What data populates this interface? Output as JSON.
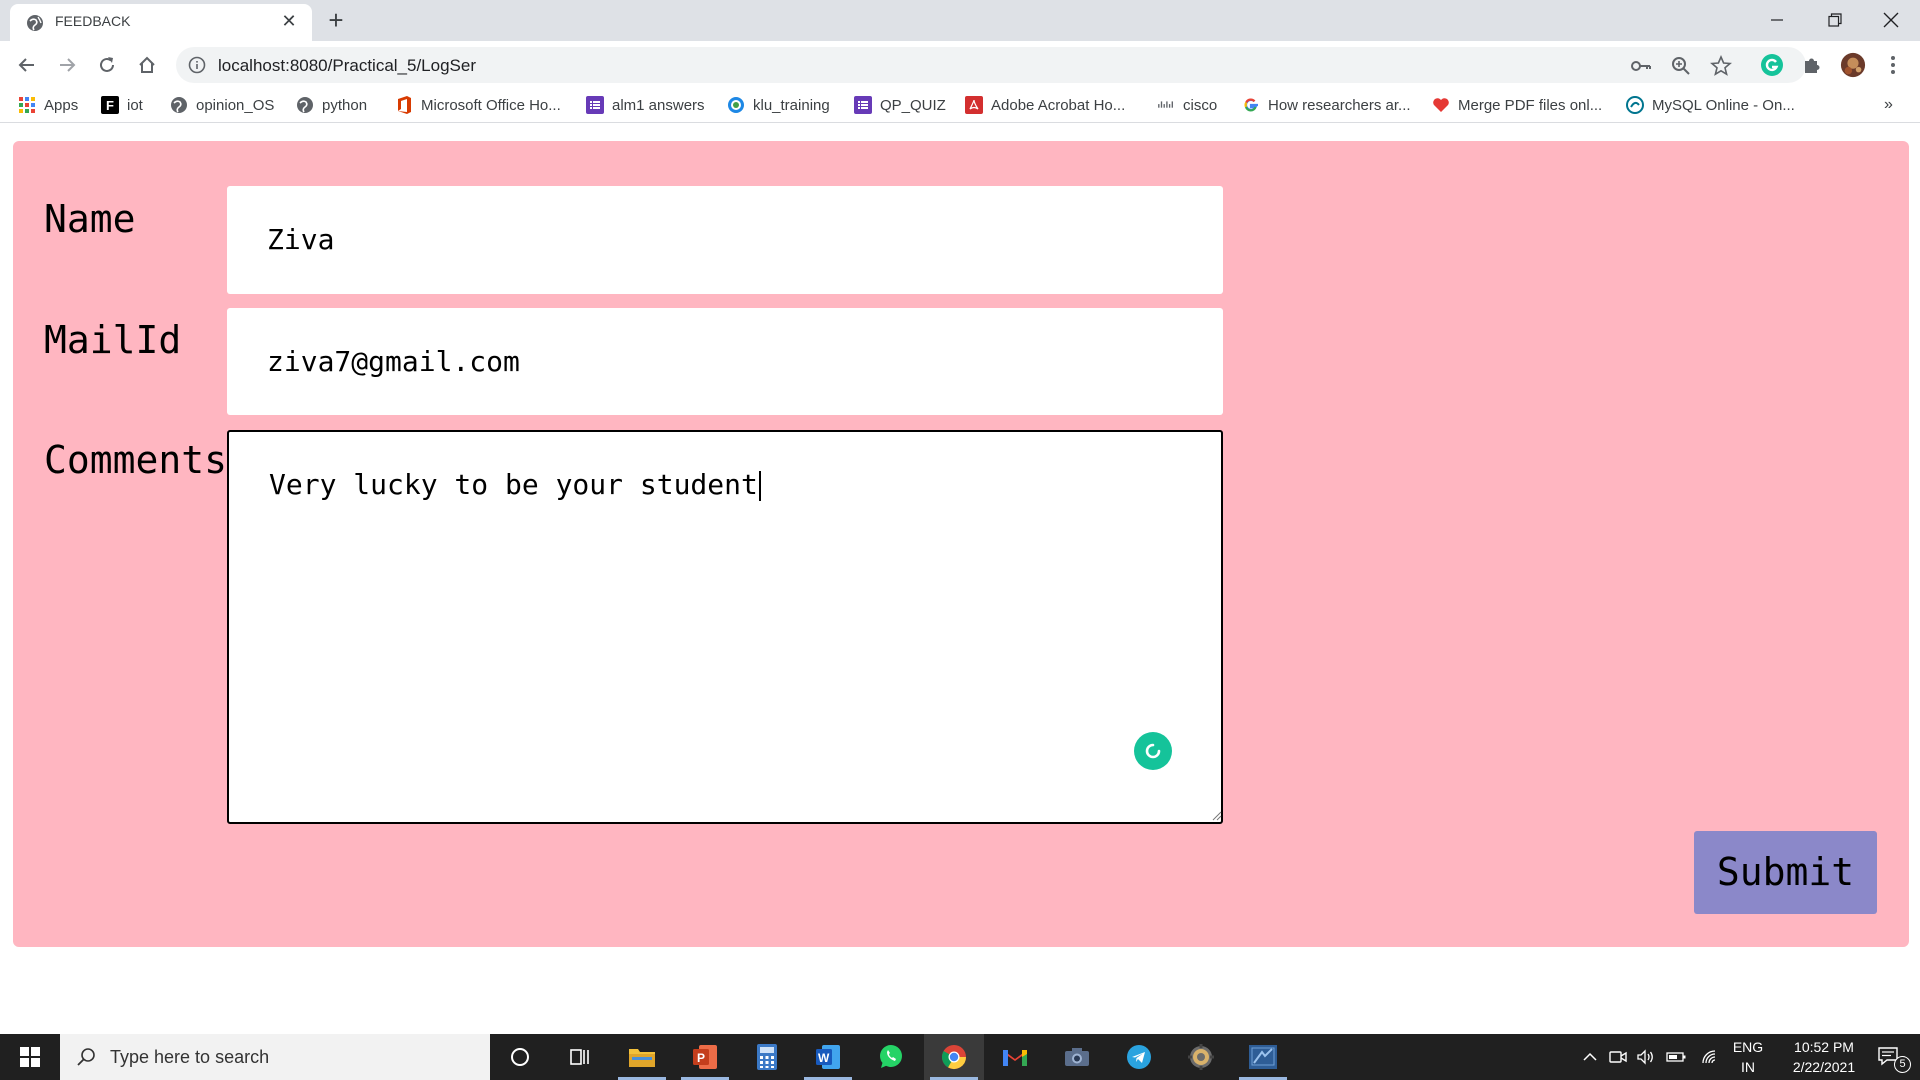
{
  "browser": {
    "tab_title": "FEEDBACK",
    "url": "localhost:8080/Practical_5/LogSer",
    "bookmarks": [
      {
        "label": "Apps",
        "icon": "apps-grid-icon",
        "color": "#4285f4"
      },
      {
        "label": "iot",
        "icon": "f-logo-icon",
        "color": "#000000"
      },
      {
        "label": "opinion_OS",
        "icon": "globe-icon",
        "color": "#5f6368"
      },
      {
        "label": "python",
        "icon": "globe-icon",
        "color": "#5f6368"
      },
      {
        "label": "Microsoft Office Ho...",
        "icon": "office-icon",
        "color": "#d83b01"
      },
      {
        "label": "alm1 answers",
        "icon": "forms-icon",
        "color": "#673ab7"
      },
      {
        "label": "klu_training",
        "icon": "klu-icon",
        "color": "#1e88e5"
      },
      {
        "label": "QP_QUIZ",
        "icon": "forms-icon",
        "color": "#673ab7"
      },
      {
        "label": "Adobe Acrobat Ho...",
        "icon": "acrobat-icon",
        "color": "#d32f2f"
      },
      {
        "label": "cisco",
        "icon": "cisco-icon",
        "color": "#5f6368"
      },
      {
        "label": "How researchers ar...",
        "icon": "google-icon",
        "color": "#ea4335"
      },
      {
        "label": "Merge PDF files onl...",
        "icon": "heart-icon",
        "color": "#e53935"
      },
      {
        "label": "MySQL Online - On...",
        "icon": "mysql-icon",
        "color": "#00758f"
      }
    ]
  },
  "form": {
    "name_label": "Name",
    "name_value": "Ziva",
    "mail_label": "MailId",
    "mail_value": "ziva7@gmail.com",
    "comments_label": "Comments",
    "comments_value": "Very lucky to be your student",
    "submit_label": "Submit"
  },
  "taskbar": {
    "search_placeholder": "Type here to search",
    "language_line1": "ENG",
    "language_line2": "IN",
    "time": "10:52 PM",
    "date": "2/22/2021",
    "notification_count": "5"
  },
  "colors": {
    "panel_background": "#ffb6c1",
    "submit_background": "#8b88c9",
    "grammarly": "#15c39a"
  }
}
